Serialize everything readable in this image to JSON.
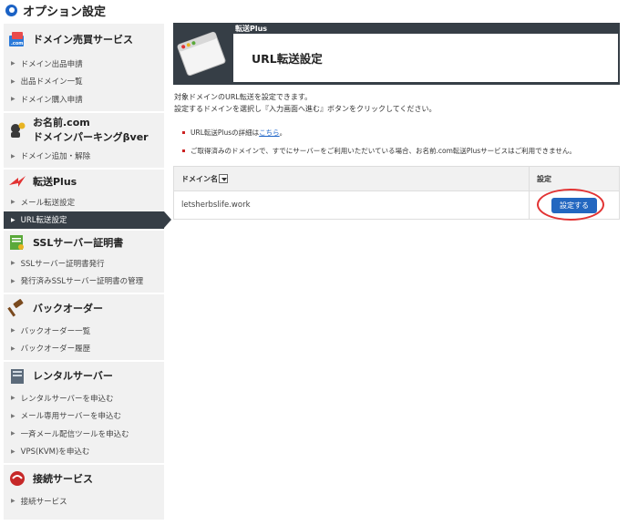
{
  "page": {
    "title": "オプション設定"
  },
  "sidebar": {
    "sections": [
      {
        "title": "ドメイン売買サービス",
        "items": [
          "ドメイン出品申請",
          "出品ドメイン一覧",
          "ドメイン購入申請"
        ]
      },
      {
        "title_line1": "お名前.com",
        "title_line2": "ドメインパーキングβver",
        "items": [
          "ドメイン追加・解除"
        ]
      },
      {
        "title": "転送Plus",
        "items": [
          "メール転送設定",
          "URL転送設定"
        ]
      },
      {
        "title": "SSLサーバー証明書",
        "items": [
          "SSLサーバー証明書発行",
          "発行済みSSLサーバー証明書の管理"
        ]
      },
      {
        "title": "バックオーダー",
        "items": [
          "バックオーダー一覧",
          "バックオーダー履歴"
        ]
      },
      {
        "title": "レンタルサーバー",
        "items": [
          "レンタルサーバーを申込む",
          "メール専用サーバーを申込む",
          "一斉メール配信ツールを申込む",
          "VPS(KVM)を申込む"
        ]
      },
      {
        "title": "接続サービス",
        "items": [
          "接続サービス"
        ]
      }
    ],
    "active_item": "URL転送設定"
  },
  "banner": {
    "label": "転送Plus",
    "title": "URL転送設定"
  },
  "description": {
    "line1": "対象ドメインのURL転送を設定できます。",
    "line2": "設定するドメインを選択し『入力画面へ進む』ボタンをクリックしてください。"
  },
  "notes": {
    "note1_prefix": "URL転送Plusの詳細は",
    "note1_link": "こちら",
    "note1_suffix": "。",
    "note2": "ご取得済みのドメインで、すでにサーバーをご利用いただいている場合、お名前.com転送Plusサービスはご利用できません。"
  },
  "table": {
    "headers": {
      "domain": "ドメイン名",
      "setting": "設定"
    },
    "rows": [
      {
        "domain": "letsherbslife.work",
        "button": "設定する"
      }
    ]
  },
  "colors": {
    "accent": "#1b62c5",
    "dark": "#363e46",
    "button": "#2367c0",
    "highlight": "#e23333"
  }
}
